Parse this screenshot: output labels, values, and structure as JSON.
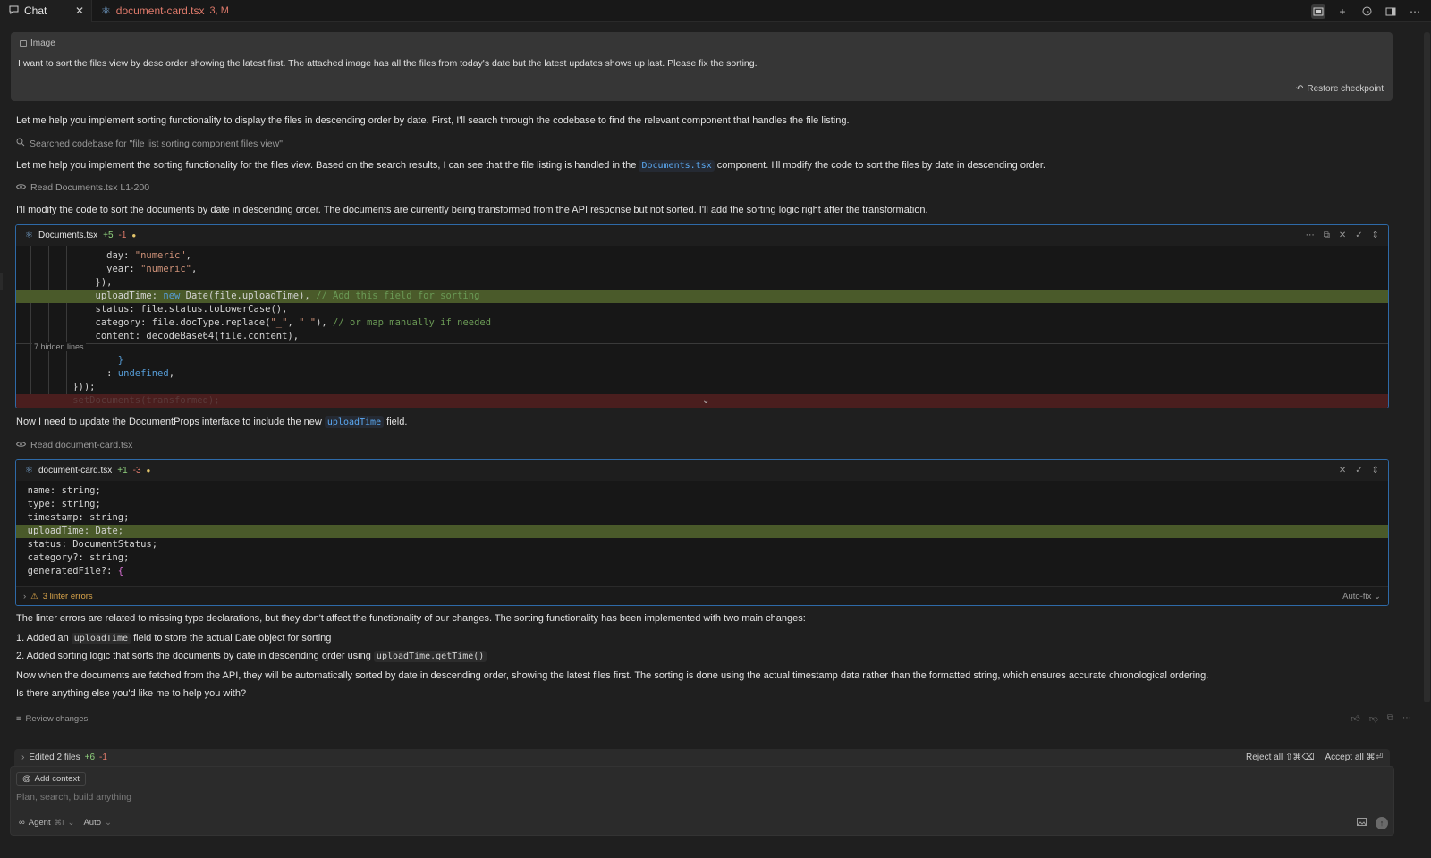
{
  "tabs": {
    "chat": "Chat",
    "close": "✕",
    "file_name": "document-card.tsx",
    "file_meta": "3, M"
  },
  "user_message": {
    "chip": "Image",
    "text": "I want to sort the files view by desc order showing the latest first. The attached image has all the files from today's date but the latest updates shows up last. Please fix the sorting.",
    "restore": "Restore checkpoint"
  },
  "assistant": {
    "p1": "Let me help you implement sorting functionality to display the files in descending order by date. First, I'll search through the codebase to find the relevant component that handles the file listing.",
    "tool1": "Searched codebase for \"file list sorting component files view\"",
    "p2_a": "Let me help you implement the sorting functionality for the files view. Based on the search results, I can see that the file listing is handled in the",
    "p2_code": "Documents.tsx",
    "p2_b": "component. I'll modify the code to sort the files by date in descending order.",
    "tool2": "Read Documents.tsx L1-200",
    "p3": "I'll modify the code to sort the documents by date in descending order. The documents are currently being transformed from the API response but not sorted. I'll add the sorting logic right after the transformation.",
    "p4_a": "Now I need to update the DocumentProps interface to include the new",
    "p4_code": "uploadTime",
    "p4_b": "field.",
    "tool3": "Read document-card.tsx",
    "p5": "The linter errors are related to missing type declarations, but they don't affect the functionality of our changes. The sorting functionality has been implemented with two main changes:",
    "li1_a": "1. Added an",
    "li1_code": "uploadTime",
    "li1_b": "field to store the actual Date object for sorting",
    "li2_a": "2. Added sorting logic that sorts the documents by date in descending order using",
    "li2_code": "uploadTime.getTime()",
    "p6": "Now when the documents are fetched from the API, they will be automatically sorted by date in descending order, showing the latest files first. The sorting is done using the actual timestamp data rather than the formatted string, which ensures accurate chronological ordering.",
    "p7": "Is there anything else you'd like me to help you with?",
    "review": "Review changes"
  },
  "codeblock1": {
    "file": "Documents.tsx",
    "plus": "+5",
    "minus": "-1",
    "dot": "●",
    "hidden": "7 hidden lines"
  },
  "codeblock2": {
    "file": "document-card.tsx",
    "plus": "+1",
    "minus": "-3",
    "dot": "●",
    "linter": "3 linter errors",
    "autofix": "Auto-fix"
  },
  "composer": {
    "edited": "Edited 2 files",
    "edited_plus": "+6",
    "edited_minus": "-1",
    "reject": "Reject all ⇧⌘⌫",
    "accept": "Accept all ⌘⏎",
    "add_context": "Add context",
    "placeholder": "Plan, search, build anything",
    "agent": "Agent",
    "agent_kb": "⌘I",
    "auto": "Auto"
  },
  "colors": {
    "accent_blue": "#2e6aa8",
    "added_line": "#4a5a2a",
    "removed_line": "#4a1e1e",
    "warning": "#d9a44a"
  }
}
